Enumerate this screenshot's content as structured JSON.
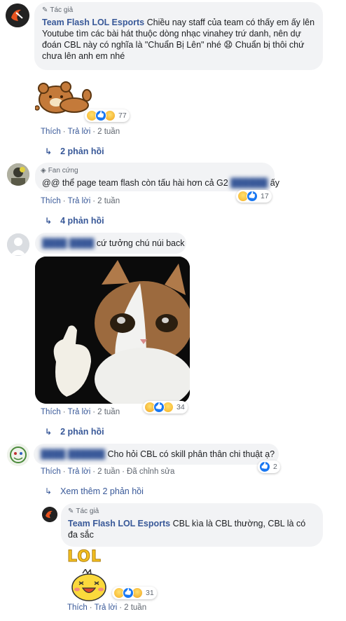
{
  "comments": [
    {
      "badge": "Tác giả",
      "author": "Team Flash LOL Esports",
      "text": "Chiều nay staff của team có thấy em ấy lên Youtube tìm các bài hát thuộc dòng nhạc vinahey trứ danh, nên dự đoán CBL này có nghĩa là \"Chuẩn Bị Lên\" nhé 😧 Chuẩn bị thôi chứ chưa lên anh em nhé",
      "reaction_count": "77",
      "like": "Thích",
      "reply": "Trả lời",
      "time": "2 tuần",
      "replies": "2 phản hồi"
    },
    {
      "badge": "Fan cứng",
      "text_prefix": "@@ thể page team flash còn tấu hài hơn cả G2",
      "text_suffix": "ấy",
      "reaction_count": "17",
      "like": "Thích",
      "reply": "Trả lời",
      "time": "2 tuần",
      "replies": "4 phản hồi"
    },
    {
      "text": "cứ tưởng chú núi back",
      "reaction_count": "34",
      "like": "Thích",
      "reply": "Trả lời",
      "time": "2 tuần",
      "replies": "2 phản hồi"
    },
    {
      "text": "Cho hỏi CBL có skill phân thân chi thuật ạ?",
      "reaction_count": "2",
      "like": "Thích",
      "reply": "Trả lời",
      "time": "2 tuần",
      "edited": "Đã chỉnh sửa",
      "more_replies": "Xem thêm 2 phản hồi"
    },
    {
      "badge": "Tác giả",
      "author": "Team Flash LOL Esports",
      "text": "CBL kìa là CBL thường, CBL là có đa sắc",
      "sticker_text": "LOL",
      "reaction_count": "31",
      "like": "Thích",
      "reply": "Trả lời",
      "time": "2 tuần"
    }
  ],
  "colors": {
    "link": "#385898",
    "bubble": "#f2f3f5",
    "meta": "#606770",
    "like_blue": "#1877f2"
  }
}
